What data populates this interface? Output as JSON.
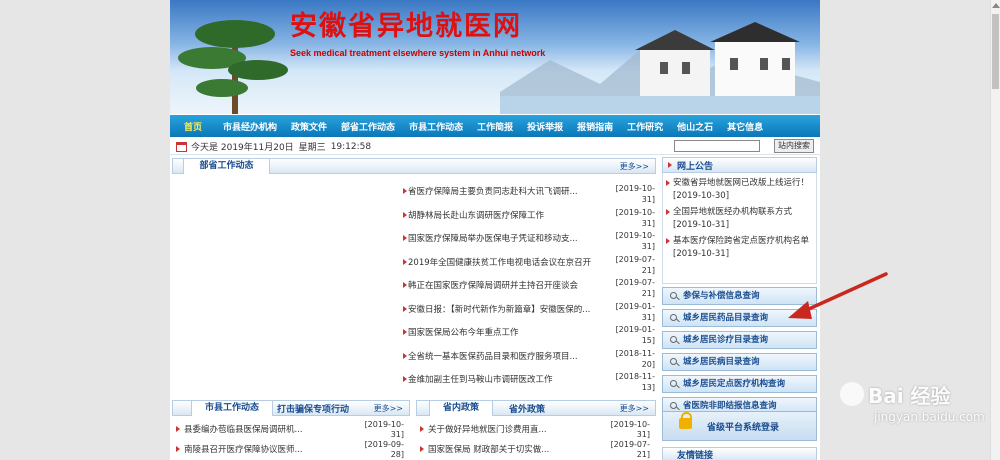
{
  "banner": {
    "title": "安徽省异地就医网",
    "subtitle": "Seek medical treatment elsewhere system in Anhui network"
  },
  "nav": {
    "items": [
      "首页",
      "市县经办机构",
      "政策文件",
      "部省工作动态",
      "市县工作动态",
      "工作简报",
      "投诉举报",
      "报销指南",
      "工作研究",
      "他山之石",
      "其它信息"
    ]
  },
  "infobar": {
    "date": "今天是 2019年11月20日",
    "weekday": "星期三",
    "time": "19:12:58",
    "search_button": "站内搜索"
  },
  "ministry": {
    "tab": "部省工作动态",
    "more": "更多>>",
    "items": [
      {
        "title": "省医疗保障局主要负责同志赴科大讯飞调研...",
        "date": "[2019-10-31]"
      },
      {
        "title": "胡静林局长赴山东调研医疗保障工作",
        "date": "[2019-10-31]"
      },
      {
        "title": "国家医疗保障局举办医保电子凭证和移动支...",
        "date": "[2019-10-31]"
      },
      {
        "title": "2019年全国健康扶贫工作电视电话会议在京召开",
        "date": "[2019-07-21]"
      },
      {
        "title": "韩正在国家医疗保障局调研并主持召开座谈会",
        "date": "[2019-07-21]"
      },
      {
        "title": "安徽日报：【新时代新作为新篇章】安徽医保的...",
        "date": "[2019-01-31]"
      },
      {
        "title": "国家医保局公布今年重点工作",
        "date": "[2019-01-15]"
      },
      {
        "title": "全省统一基本医保药品目录和医疗服务项目...",
        "date": "[2018-11-20]"
      },
      {
        "title": "金维加副主任到马鞍山市调研医改工作",
        "date": "[2018-11-13]"
      }
    ]
  },
  "county": {
    "tab1": "市县工作动态",
    "tab2": "打击骗保专项行动",
    "more": "更多>>",
    "items": [
      {
        "title": "县委编办苞临县医保局调研机...",
        "date": "[2019-10-31]"
      },
      {
        "title": "南陵县召开医疗保障协议医师...",
        "date": "[2019-09-28]"
      }
    ]
  },
  "policy": {
    "tab1": "省内政策",
    "tab2": "省外政策",
    "more": "更多>>",
    "items": [
      {
        "title": "关于做好异地就医门诊费用直...",
        "date": "[2019-10-31]"
      },
      {
        "title": "国家医保局 财政部关于切实做...",
        "date": "[2019-07-21]"
      }
    ]
  },
  "notice": {
    "heading": "网上公告",
    "items": [
      {
        "title": "安徽省异地就医网已改版上线运行！",
        "date": "[2019-10-30]"
      },
      {
        "title": "全国异地就医经办机构联系方式",
        "date": "[2019-10-31]"
      },
      {
        "title": "基本医疗保险跨省定点医疗机构名单",
        "date": "[2019-10-31]"
      }
    ]
  },
  "services": [
    "参保与补偿信息查询",
    "城乡居民药品目录查询",
    "城乡居民诊疗目录查询",
    "城乡居民病目录查询",
    "城乡居民定点医疗机构查询",
    "省医院非即结报信息查询"
  ],
  "login": {
    "label": "省级平台系统登录"
  },
  "bottom_heading": "友情链接",
  "watermark": {
    "text": "Bai 经验",
    "url": "jingyan.baidu.com"
  },
  "colors": {
    "nav": "#0a77b9",
    "title_red": "#d11",
    "link_blue": "#1a4d8f",
    "annotation_arrow": "#c8281e"
  }
}
